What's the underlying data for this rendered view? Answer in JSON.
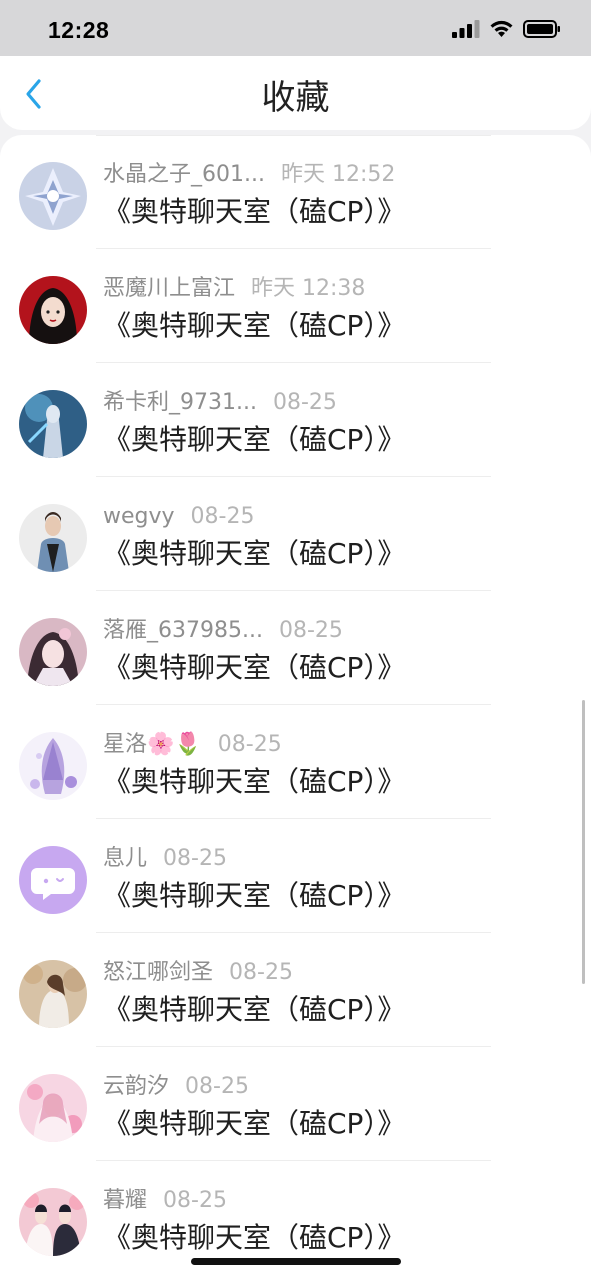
{
  "status_bar": {
    "time": "12:28"
  },
  "header": {
    "title": "收藏",
    "back_icon": "chevron-left-icon",
    "accent_color": "#2aa5e8"
  },
  "favorites": [
    {
      "username": "水晶之子_601...",
      "time": "昨天 12:52",
      "title": "《奥特聊天室（磕CP）》",
      "avatar": "avatar-crystal"
    },
    {
      "username": "恶魔川上富江",
      "time": "昨天 12:38",
      "title": "《奥特聊天室（磕CP）》",
      "avatar": "avatar-red-girl"
    },
    {
      "username": "希卡利_9731...",
      "time": "08-25",
      "title": "《奥特聊天室（磕CP）》",
      "avatar": "avatar-blue-hero"
    },
    {
      "username": "wegvy",
      "time": "08-25",
      "title": "《奥特聊天室（磕CP）》",
      "avatar": "avatar-man-photo"
    },
    {
      "username": "落雁_637985...",
      "time": "08-25",
      "title": "《奥特聊天室（磕CP）》",
      "avatar": "avatar-pink-girl"
    },
    {
      "username": "星洛🌸🌷",
      "time": "08-25",
      "title": "《奥特聊天室（磕CP）》",
      "avatar": "avatar-purple-art"
    },
    {
      "username": "息儿",
      "time": "08-25",
      "title": "《奥特聊天室（磕CP）》",
      "avatar": "avatar-chat-bubble"
    },
    {
      "username": "怒江哪剑圣",
      "time": "08-25",
      "title": "《奥特聊天室（磕CP）》",
      "avatar": "avatar-autumn-girl"
    },
    {
      "username": "云韵汐",
      "time": "08-25",
      "title": "《奥特聊天室（磕CP）》",
      "avatar": "avatar-pink-anime"
    },
    {
      "username": "暮耀",
      "time": "08-25",
      "title": "《奥特聊天室（磕CP）》",
      "avatar": "avatar-couple"
    }
  ]
}
